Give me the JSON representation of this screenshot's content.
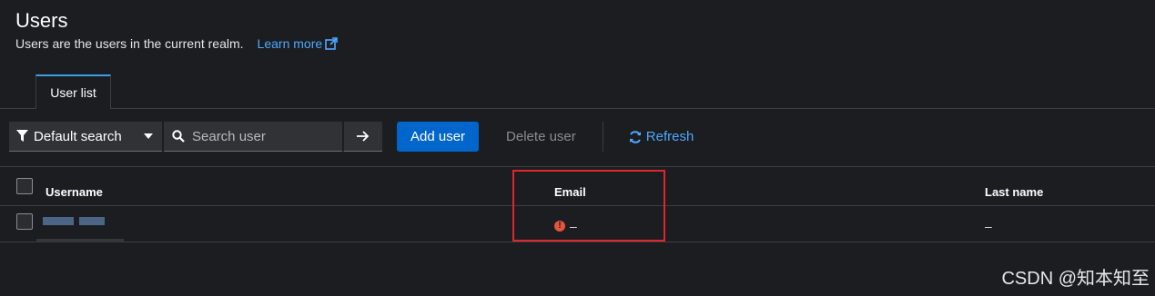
{
  "header": {
    "title": "Users",
    "subtitle": "Users are the users in the current realm.",
    "learn_more": "Learn more"
  },
  "tabs": [
    {
      "label": "User list",
      "active": true
    }
  ],
  "toolbar": {
    "filter_label": "Default search",
    "search_placeholder": "Search user",
    "add_label": "Add user",
    "delete_label": "Delete user",
    "refresh_label": "Refresh"
  },
  "table": {
    "columns": [
      "Username",
      "Email",
      "Last name"
    ],
    "rows": [
      {
        "username": "",
        "email": "–",
        "last_name": "–"
      }
    ]
  },
  "watermark": "CSDN @知本知至",
  "colors": {
    "background": "#1b1d21",
    "primary": "#0066cc",
    "link": "#4fa8ff",
    "warning": "#e5553d",
    "highlight": "#e0262b"
  }
}
